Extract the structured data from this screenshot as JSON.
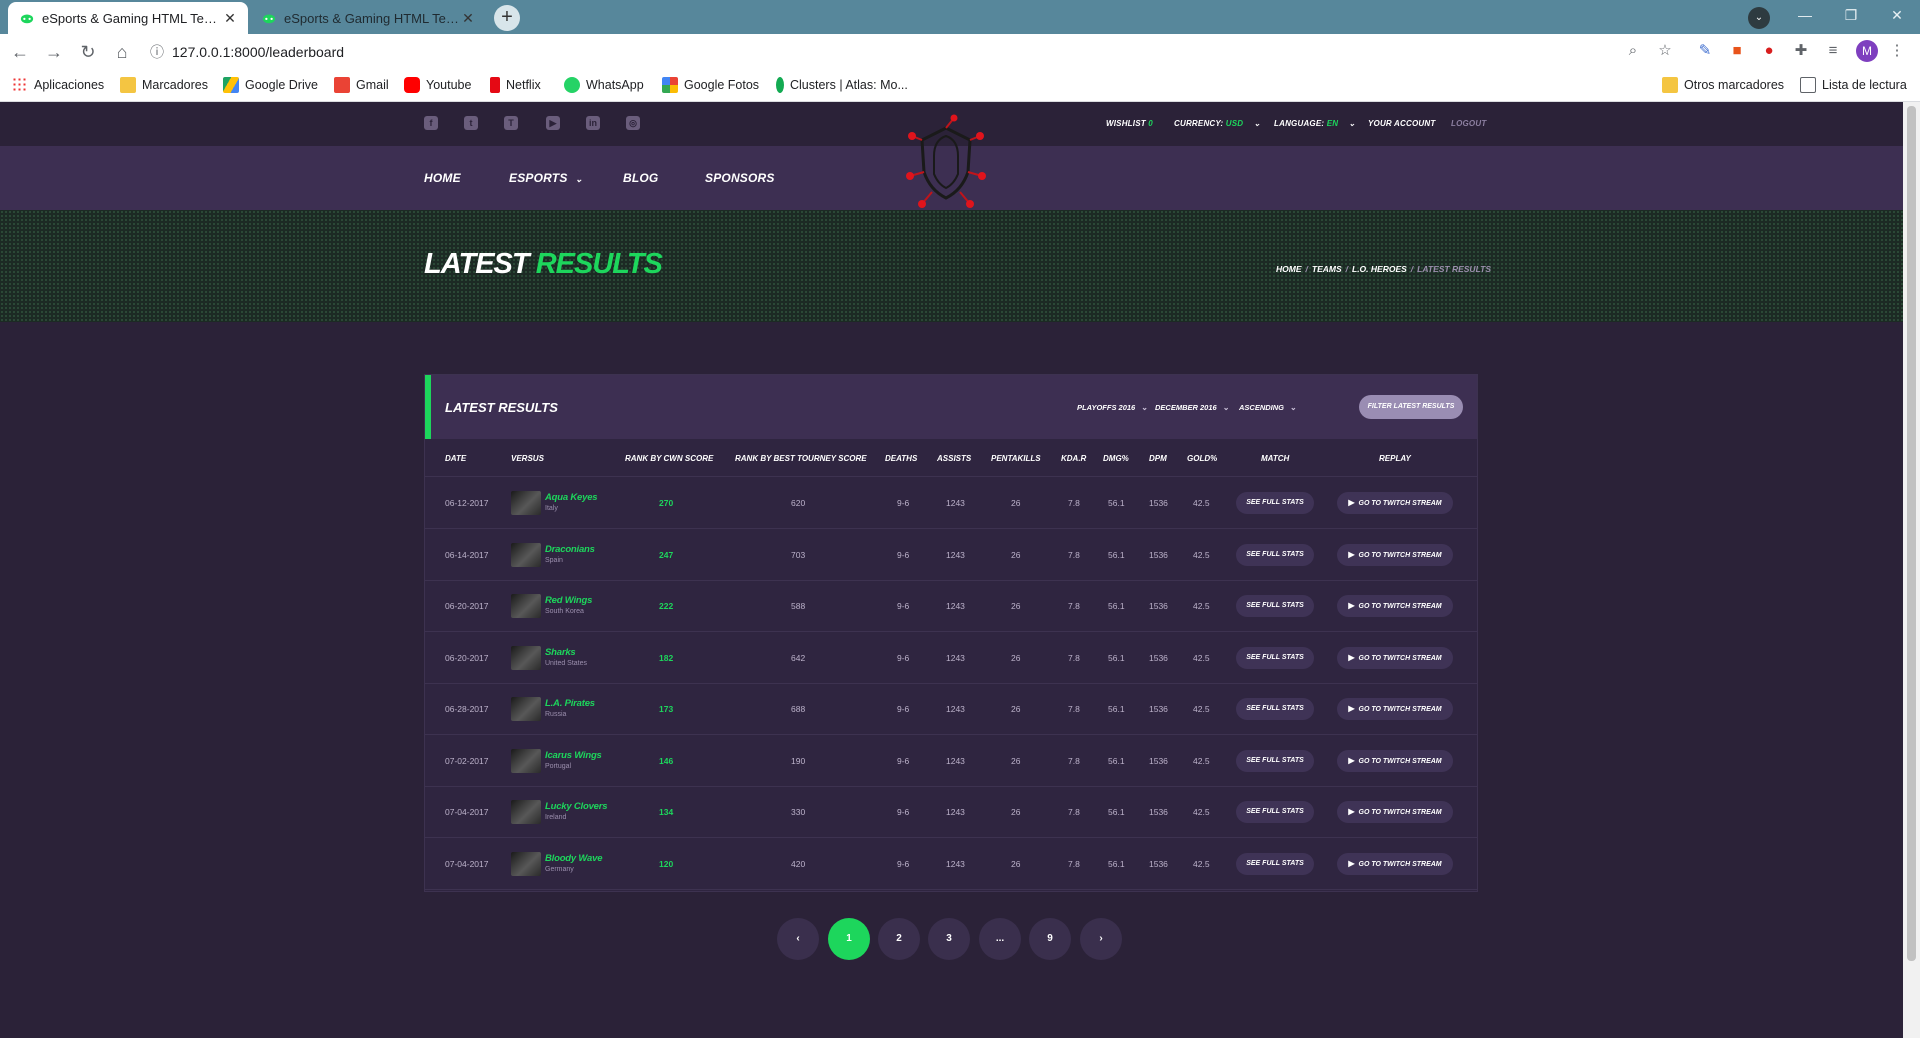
{
  "browser": {
    "tabs": [
      {
        "title": "eSports & Gaming HTML Template",
        "active": true
      },
      {
        "title": "eSports & Gaming HTML Template",
        "active": false
      }
    ],
    "url": "127.0.0.1:8000/leaderboard",
    "profile_initial": "M",
    "bookmarks": [
      "Aplicaciones",
      "Marcadores",
      "Google Drive",
      "Gmail",
      "Youtube",
      "Netflix",
      "WhatsApp",
      "Google Fotos",
      "Clusters | Atlas: Mo..."
    ],
    "bookmarks_right": [
      "Otros marcadores",
      "Lista de lectura"
    ]
  },
  "topbar": {
    "social_icons": [
      "facebook-icon",
      "twitter-icon",
      "twitch-icon",
      "youtube-icon",
      "linkedin-icon",
      "instagram-icon"
    ],
    "wishlist_label": "WISHLIST",
    "wishlist_count": "0",
    "currency_label": "CURRENCY:",
    "currency_value": "USD",
    "language_label": "LANGUAGE:",
    "language_value": "EN",
    "account": "YOUR ACCOUNT",
    "logout": "LOGOUT"
  },
  "nav": {
    "home": "HOME",
    "esports": "ESPORTS",
    "blog": "BLOG",
    "sponsors": "SPONSORS"
  },
  "hero": {
    "title_white": "LATEST",
    "title_green": "RESULTS",
    "breadcrumbs": [
      "HOME",
      "TEAMS",
      "L.O. HEROES",
      "LATEST RESULTS"
    ]
  },
  "card": {
    "title": "LATEST RESULTS",
    "filters": [
      "PLAYOFFS 2016",
      "DECEMBER 2016",
      "ASCENDING"
    ],
    "filter_button": "FILTER LATEST RESULTS",
    "columns": [
      "DATE",
      "VERSUS",
      "RANK BY CWN SCORE",
      "RANK BY BEST TOURNEY SCORE",
      "DEATHS",
      "ASSISTS",
      "PENTAKILLS",
      "KDA.R",
      "DMG%",
      "DPM",
      "GOLD%",
      "MATCH",
      "REPLAY"
    ],
    "stats_button": "SEE FULL STATS",
    "stream_button": "GO TO TWITCH STREAM",
    "rows": [
      {
        "date": "06-12-2017",
        "team": "Aqua Keyes",
        "country": "Italy",
        "cwn": "270",
        "best": "620",
        "deaths": "9-6",
        "assists": "1243",
        "penta": "26",
        "kda": "7.8",
        "dmg": "56.1",
        "dpm": "1536",
        "gold": "42.5"
      },
      {
        "date": "06-14-2017",
        "team": "Draconians",
        "country": "Spain",
        "cwn": "247",
        "best": "703",
        "deaths": "9-6",
        "assists": "1243",
        "penta": "26",
        "kda": "7.8",
        "dmg": "56.1",
        "dpm": "1536",
        "gold": "42.5"
      },
      {
        "date": "06-20-2017",
        "team": "Red Wings",
        "country": "South Korea",
        "cwn": "222",
        "best": "588",
        "deaths": "9-6",
        "assists": "1243",
        "penta": "26",
        "kda": "7.8",
        "dmg": "56.1",
        "dpm": "1536",
        "gold": "42.5"
      },
      {
        "date": "06-20-2017",
        "team": "Sharks",
        "country": "United States",
        "cwn": "182",
        "best": "642",
        "deaths": "9-6",
        "assists": "1243",
        "penta": "26",
        "kda": "7.8",
        "dmg": "56.1",
        "dpm": "1536",
        "gold": "42.5"
      },
      {
        "date": "06-28-2017",
        "team": "L.A. Pirates",
        "country": "Russia",
        "cwn": "173",
        "best": "688",
        "deaths": "9-6",
        "assists": "1243",
        "penta": "26",
        "kda": "7.8",
        "dmg": "56.1",
        "dpm": "1536",
        "gold": "42.5"
      },
      {
        "date": "07-02-2017",
        "team": "Icarus Wings",
        "country": "Portugal",
        "cwn": "146",
        "best": "190",
        "deaths": "9-6",
        "assists": "1243",
        "penta": "26",
        "kda": "7.8",
        "dmg": "56.1",
        "dpm": "1536",
        "gold": "42.5"
      },
      {
        "date": "07-04-2017",
        "team": "Lucky Clovers",
        "country": "Ireland",
        "cwn": "134",
        "best": "330",
        "deaths": "9-6",
        "assists": "1243",
        "penta": "26",
        "kda": "7.8",
        "dmg": "56.1",
        "dpm": "1536",
        "gold": "42.5"
      },
      {
        "date": "07-04-2017",
        "team": "Bloody Wave",
        "country": "Germany",
        "cwn": "120",
        "best": "420",
        "deaths": "9-6",
        "assists": "1243",
        "penta": "26",
        "kda": "7.8",
        "dmg": "56.1",
        "dpm": "1536",
        "gold": "42.5"
      }
    ]
  },
  "pagination": {
    "prev": "‹",
    "pages": [
      "1",
      "2",
      "3",
      "...",
      "9"
    ],
    "next": "›",
    "active_page": "1"
  },
  "colors": {
    "accent": "#1dd65c",
    "page_bg": "#2b2238",
    "nav_bg": "#3d2f52"
  }
}
